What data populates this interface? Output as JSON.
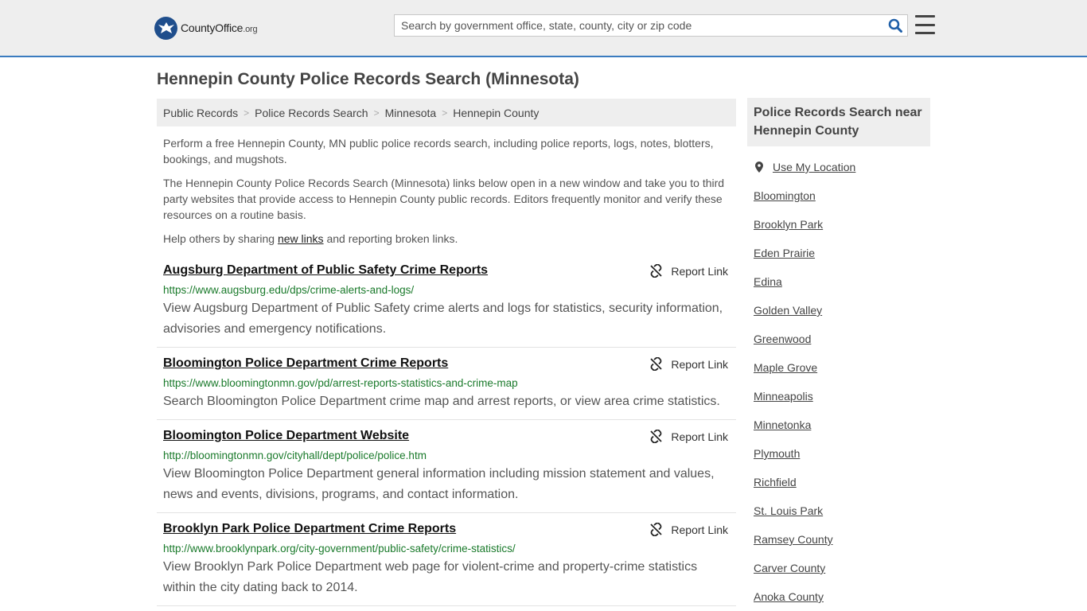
{
  "header": {
    "logo_brand": "CountyOffice",
    "logo_tld": ".org",
    "search_placeholder": "Search by government office, state, county, city or zip code"
  },
  "page_title": "Hennepin County Police Records Search (Minnesota)",
  "breadcrumb": [
    "Public Records",
    "Police Records Search",
    "Minnesota",
    "Hennepin County"
  ],
  "intro": {
    "p1": "Perform a free Hennepin County, MN public police records search, including police reports, logs, notes, blotters, bookings, and mugshots.",
    "p2": "The Hennepin County Police Records Search (Minnesota) links below open in a new window and take you to third party websites that provide access to Hennepin County public records. Editors frequently monitor and verify these resources on a routine basis.",
    "p3_before": "Help others by sharing ",
    "p3_link": "new links",
    "p3_after": " and reporting broken links."
  },
  "report_label": "Report Link",
  "results": [
    {
      "title": "Augsburg Department of Public Safety Crime Reports",
      "url": "https://www.augsburg.edu/dps/crime-alerts-and-logs/",
      "desc": "View Augsburg Department of Public Safety crime alerts and logs for statistics, security information, advisories and emergency notifications."
    },
    {
      "title": "Bloomington Police Department Crime Reports",
      "url": "https://www.bloomingtonmn.gov/pd/arrest-reports-statistics-and-crime-map",
      "desc": "Search Bloomington Police Department crime map and arrest reports, or view area crime statistics."
    },
    {
      "title": "Bloomington Police Department Website",
      "url": "http://bloomingtonmn.gov/cityhall/dept/police/police.htm",
      "desc": "View Bloomington Police Department general information including mission statement and values, news and events, divisions, programs, and contact information."
    },
    {
      "title": "Brooklyn Park Police Department Crime Reports",
      "url": "http://www.brooklynpark.org/city-government/public-safety/crime-statistics/",
      "desc": "View Brooklyn Park Police Department web page for violent-crime and property-crime statistics within the city dating back to 2014."
    }
  ],
  "sidebar": {
    "heading": "Police Records Search near Hennepin County",
    "use_location": "Use My Location",
    "links": [
      "Bloomington",
      "Brooklyn Park",
      "Eden Prairie",
      "Edina",
      "Golden Valley",
      "Greenwood",
      "Maple Grove",
      "Minneapolis",
      "Minnetonka",
      "Plymouth",
      "Richfield",
      "St. Louis Park",
      "Ramsey County",
      "Carver County",
      "Anoka County"
    ]
  }
}
